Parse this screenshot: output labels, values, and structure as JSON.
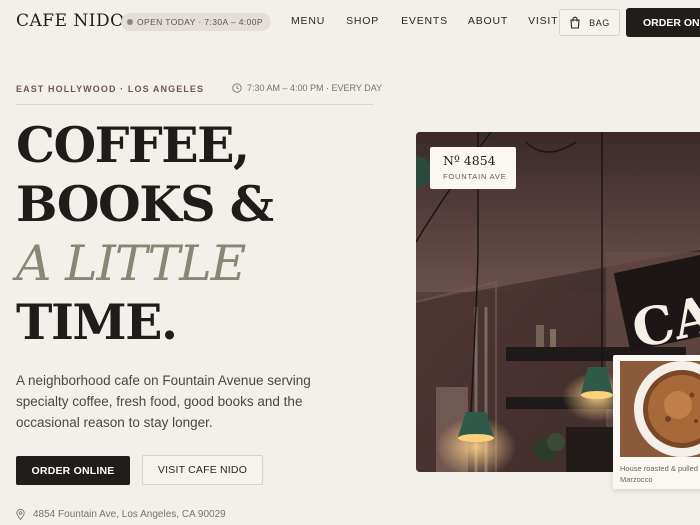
{
  "header": {
    "logo": "CAFE NIDO",
    "status": "OPEN TODAY · 7:30A – 4:00P",
    "nav": [
      "MENU",
      "SHOP",
      "EVENTS",
      "ABOUT",
      "VISIT"
    ],
    "bag_label": "BAG",
    "order_label": "ORDER ONLINE"
  },
  "meta": {
    "location": "EAST HOLLYWOOD · LOS ANGELES",
    "hours": "7:30 AM – 4:00 PM · EVERY DAY"
  },
  "hero": {
    "line1": "COFFEE,",
    "line2": "BOOKS &",
    "line3": "A LITTLE",
    "line4": "TIME.",
    "intro": "A neighborhood cafe on Fountain Avenue serving specialty coffee, fresh food, good books and the occasional reason to stay longer.",
    "primary_cta": "ORDER ONLINE",
    "secondary_cta": "VISIT CAFE NIDO",
    "address": "4854 Fountain Ave, Los Angeles, CA 90029"
  },
  "photo_card": {
    "number": "Nº 4854",
    "street": "FOUNTAIN AVE"
  },
  "coffee_card": {
    "caption_line1": "House roasted & pulled on a",
    "caption_line2": "Marzocco"
  },
  "colors": {
    "background": "#f3efeb",
    "ink": "#1f1c1a",
    "accent_brown": "#6d5a4c",
    "italic_olive": "#8a8676",
    "button_dark": "#211d1b"
  },
  "icons": [
    "status-dot-icon",
    "bag-icon",
    "clock-icon",
    "location-pin-icon"
  ]
}
